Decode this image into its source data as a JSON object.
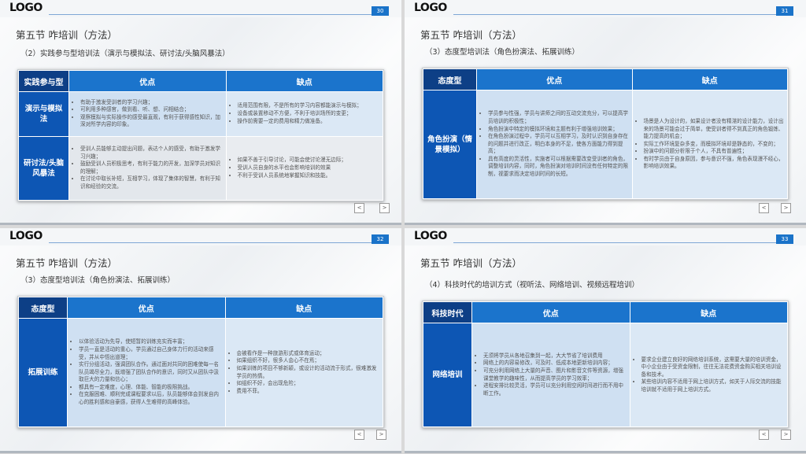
{
  "slides": [
    {
      "logo": "LOGO",
      "page": "30",
      "section": "第五节  咋培训（方法）",
      "subtitle": "（2）实践参与型培训法（演示与模拟法、研讨法/头脑风暴法）",
      "headers": [
        "实践参与型",
        "优点",
        "缺点"
      ],
      "rows": [
        {
          "label": "演示与模拟法",
          "pros": [
            "有助于激发受训者的学习兴趣；",
            "可利用多种感官，做到看、听、想、问相结合；",
            "观察模拟与实际操作的感受最直观，有利于获得感性知识，加深对所学内容的印象。"
          ],
          "cons": [
            "适用范围有限，不是所有的学习内容都能演示与模拟；",
            "设备或装置移动不方便，不利于培训场所的变更；",
            "操作前需要一定的费用和精力做准备。"
          ]
        },
        {
          "label": "研讨法/头脑风暴法",
          "pros": [
            "受训人员能够主动提出问题，表达个人的感受，有助于激发学习兴趣；",
            "鼓励受训人员积极思考，有利于能力的开发，加深学员对知识的理解；",
            "在讨论中取长补短，互相学习，体现了集体的智慧，有利于知识和经验的交流。"
          ],
          "cons": [
            "如果不善于引导讨论，可能会使讨论漫无边际；",
            "受训人员自身的水平也会影响培训的效果",
            "不利于受训人员系统地掌握知识和技能。"
          ]
        }
      ]
    },
    {
      "logo": "LOGO",
      "page": "31",
      "section": "第五节  咋培训（方法）",
      "subtitle": "（3）态度型培训法（角色扮演法、拓展训练）",
      "headers": [
        "态度型",
        "优点",
        "缺点"
      ],
      "rows": [
        {
          "label": "角色扮演（情景模拟）",
          "pros": [
            "学员参与性强，学员与讲师之间的互动交流充分，可以提高学员培训的积极性；",
            "角色扮演中特定的模拟环境和主题有利于增强培训效果；",
            "在角色扮演过程中，学员可以互相学习，及时认识到自身存在的问题并进行改正，明白本身的不足，使各方面能力得到提高；",
            "具有高度的灵活性，实施者可以根据需要改变受训者的角色，调整培训内容，同时，角色扮演对培训时间没有任何特定的限制，视要求而决定培训时间的长短。"
          ],
          "cons": [
            "场景是人为设计的，如果设计者没有精湛的设计能力，设计出来的场景可能会过于简单，使受训者得不到真正的角色锻炼、能力提高的机会；",
            "实际工作环境复杂多变，而模拟环境却是静态的，不变的；",
            "扮演中的问题分析限于个人，不具有普遍性；",
            "有时学员由于自身原因，参与意识不强，角色表现漫不经心，影响培训效果。"
          ]
        }
      ]
    },
    {
      "logo": "LOGO",
      "page": "32",
      "section": "第五节  咋培训（方法）",
      "subtitle": "（3）态度型培训法（角色扮演法、拓展训练）",
      "headers": [
        "态度型",
        "优点",
        "缺点"
      ],
      "rows": [
        {
          "label": "拓展训练",
          "pros": [
            "以体验活动为先导，使短暂的训练充实而丰富；",
            "学员一直是活动的重心，学员通过自己身体力行的活动来感受，并从中悟出道理；",
            "实行分组活动，强调团队合作。通过面对共同的困难使每一名队员竭尽全力，既增强了团队合作的意识，同时又从团队中汲取巨大的力量和信心；",
            "都具有一定难度，心理、体能、智能的极限挑战。",
            "在克服困难、顺利完成课程要求以后，队员能够体会到发自内心的胜利感和自豪感，获得人生难得的高峰体验。"
          ],
          "cons": [
            "会被看作是一种旅游形式或体育运动；",
            "如果组织不好，很多人会心不在焉；",
            "如果训练的项目不够新颖，或设计的活动流于形式，很难激发学员的热情。",
            "如组织不好，会出现危险；",
            "费用不菲。"
          ]
        }
      ]
    },
    {
      "logo": "LOGO",
      "page": "33",
      "section": "第五节  咋培训（方法）",
      "subtitle": "（4）科技时代的培训方式（视听法、网络培训、视频远程培训）",
      "headers": [
        "科技时代",
        "优点",
        "缺点"
      ],
      "rows": [
        {
          "label": "网络培训",
          "pros": [
            "无须将学员从各地召集到一起，大大节省了培训费用",
            "网络上的内容易修改，可及时、低成本地更新培训内容；",
            "可充分利用网络上大量的声音、图片和影音文件等资源，增强课堂教学的趣味性，从而提高学员的学习效率；",
            "进程安排比较灵活，学员可以充分利用空闲时间进行而不用中断工作。"
          ],
          "cons": [
            "要求企业建立良好的网络培训系统，这需要大量的培训资金，中小企业由于受资金限制，往往无法花费资金购买相关培训设备和技术。",
            "某些培训内容不适用于网上培训方式，如关于人际交流的技能培训就不适用于网上培训方式。"
          ]
        }
      ]
    }
  ],
  "nav": {
    "prev": "<",
    "next": ">"
  }
}
